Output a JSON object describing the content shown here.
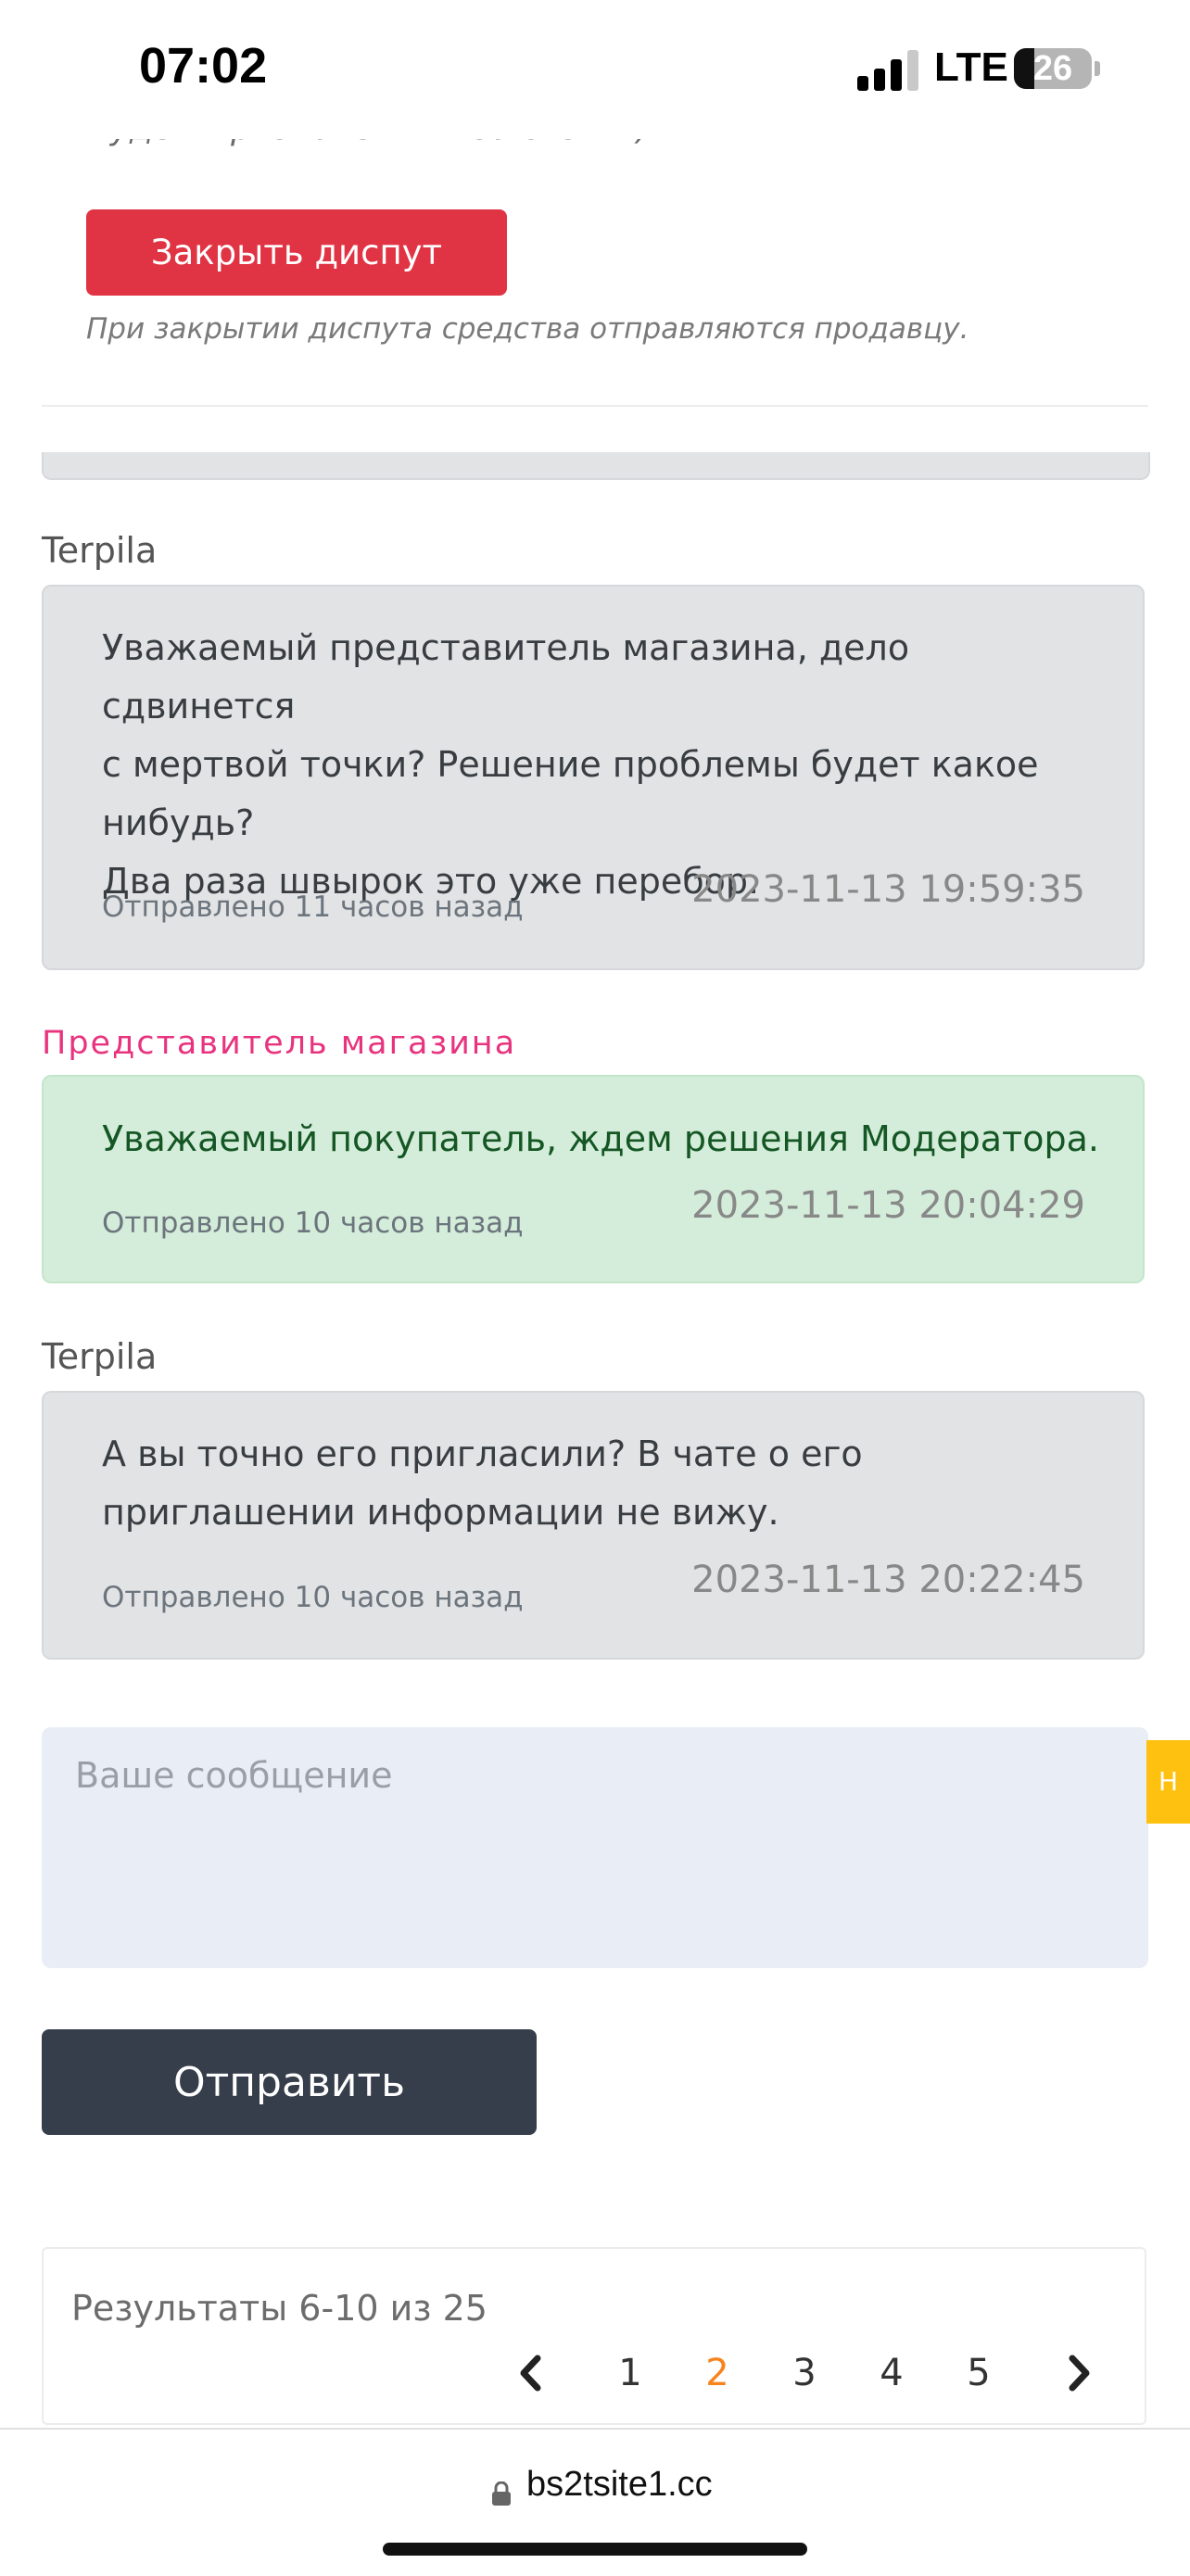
{
  "status_bar": {
    "time": "07:02",
    "network": "LTE",
    "battery": "26",
    "battery_level": 0.26
  },
  "top": {
    "cut_text": "Будем признательны за отзыв )",
    "close_button": "Закрыть диспут",
    "close_note": "При закрытии диспута средства отправляются продавцу."
  },
  "messages": [
    {
      "author": "Terpila",
      "role": "user",
      "text": "Уважаемый представитель магазина, дело сдвинется\nс мертвой точки? Решение проблемы будет какое\nнибудь?\nДва раза швырок это уже перебор.",
      "sent": "Отправлено 11 часов назад",
      "date": "2023-11-13 19:59:35"
    },
    {
      "author": "Представитель магазина",
      "role": "shop",
      "text": "Уважаемый покупатель, ждем решения Модератора.",
      "sent": "Отправлено 10 часов назад",
      "date": "2023-11-13 20:04:29"
    },
    {
      "author": "Terpila",
      "role": "user",
      "text": "А вы точно его пригласили? В чате о его\nприглашении информации не вижу.",
      "sent": "Отправлено 10 часов назад",
      "date": "2023-11-13 20:22:45"
    }
  ],
  "form": {
    "placeholder": "Ваше сообщение",
    "send_label": "Отправить",
    "side_tab_label": "Н"
  },
  "pagination": {
    "results": "Результаты 6-10 из 25",
    "pages": [
      "1",
      "2",
      "3",
      "4",
      "5"
    ],
    "current": "2",
    "prev_icon": "chevron-left-icon",
    "next_icon": "chevron-right-icon"
  },
  "browser": {
    "url": "bs2tsite1.cc",
    "lock_icon": "lock-icon"
  },
  "colors": {
    "danger": "#e03444",
    "shop_author": "#e8347f",
    "active_page": "#f7831e",
    "send_button": "#363e4b"
  }
}
